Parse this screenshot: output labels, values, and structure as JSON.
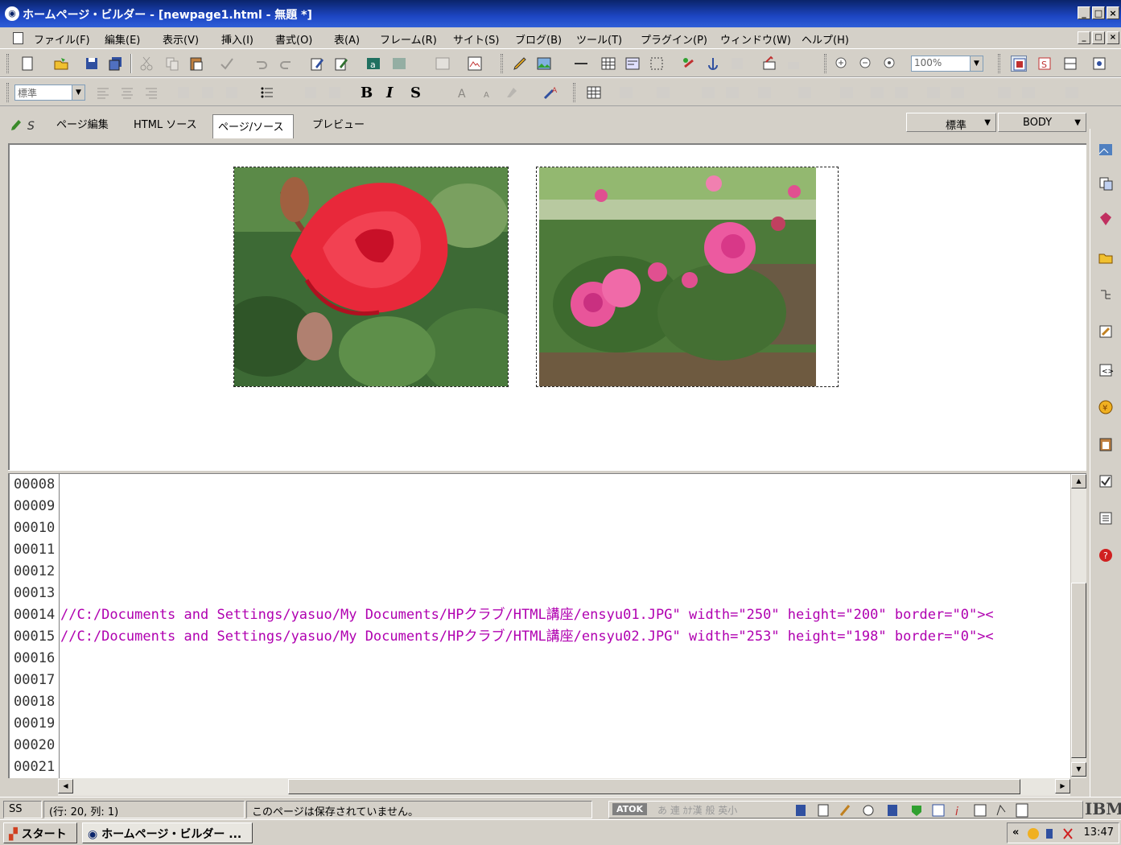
{
  "window": {
    "title": "ホームページ・ビルダー - [newpage1.html - 無題 *]",
    "min": "_",
    "max": "□",
    "close": "×"
  },
  "menu": {
    "items": [
      "ファイル(F)",
      "編集(E)",
      "表示(V)",
      "挿入(I)",
      "書式(O)",
      "表(A)",
      "フレーム(R)",
      "サイト(S)",
      "ブログ(B)",
      "ツール(T)",
      "プラグイン(P)",
      "ウィンドウ(W)",
      "ヘルプ(H)"
    ]
  },
  "toolbar1": {
    "zoom_value": "100%"
  },
  "toolbar2": {
    "style_value": "標準",
    "bold": "B",
    "italic": "I",
    "strike": "S"
  },
  "view_tabs": {
    "items": [
      "ページ編集",
      "HTML ソース",
      "ページ/ソース",
      "プレビュー"
    ],
    "active_index": 2,
    "style_select": "標準",
    "tag_select": "BODY"
  },
  "source": {
    "line_numbers": [
      "00008",
      "00009",
      "00010",
      "00011",
      "00012",
      "00013",
      "00014",
      "00015",
      "00016",
      "00017",
      "00018",
      "00019",
      "00020",
      "00021"
    ],
    "lines": {
      "line14": "//C:/Documents and Settings/yasuo/My Documents/HPクラブ/HTML講座/ensyu01.JPG\" width=\"250\" height=\"200\" border=\"0\"><",
      "line15": "//C:/Documents and Settings/yasuo/My Documents/HPクラブ/HTML講座/ensyu02.JPG\" width=\"253\" height=\"198\" border=\"0\"><"
    }
  },
  "status": {
    "mode": "SS",
    "position": "(行: 20, 列: 1)",
    "message": "このページは保存されていません。",
    "ime": "ATOK",
    "ime_modes": "あ 連 ｶﾅ漢 般 英小",
    "brand": "IBM"
  },
  "taskbar": {
    "start": "スタート",
    "app_button": "ホームページ・ビルダー ...",
    "tray_arrows": "«",
    "time": "13:47"
  },
  "colors": {
    "titlebar": "#0a246a",
    "source_text": "#b000b0"
  }
}
